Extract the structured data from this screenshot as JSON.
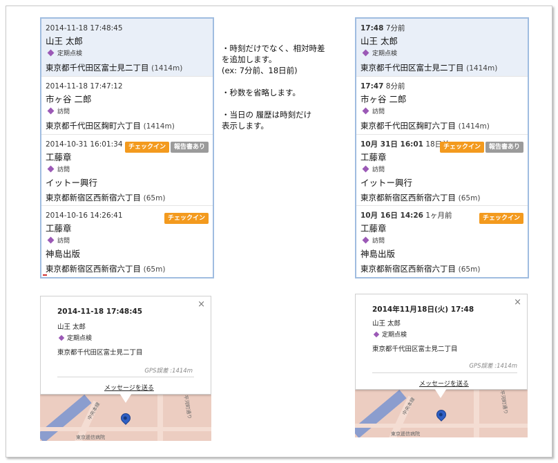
{
  "left_list": {
    "items": [
      {
        "time": "2014-11-18 17:48:45",
        "name": "山王 太郎",
        "tag": "定期点検",
        "sub": "",
        "address": "東京都千代田区富士見二丁目",
        "distance": "(1414m)",
        "badges": []
      },
      {
        "time": "2014-11-18 17:47:12",
        "name": "市ヶ谷 二郎",
        "tag": "訪問",
        "sub": "",
        "address": "東京都千代田区麹町六丁目",
        "distance": "(1414m)",
        "badges": []
      },
      {
        "time": "2014-10-31 16:01:34",
        "name": "工藤章",
        "tag": "訪問",
        "sub": "イットー興行",
        "address": "東京都新宿区西新宿六丁目",
        "distance": "(65m)",
        "badges": [
          "チェックイン",
          "報告書あり"
        ]
      },
      {
        "time": "2014-10-16 14:26:41",
        "name": "工藤章",
        "tag": "訪問",
        "sub": "神島出版",
        "address": "東京都新宿区西新宿六丁目",
        "distance": "(65m)",
        "badges": [
          "チェックイン"
        ]
      }
    ]
  },
  "right_list": {
    "items": [
      {
        "time": "17:48",
        "rel": "7分前",
        "name": "山王 太郎",
        "tag": "定期点検",
        "sub": "",
        "address": "東京都千代田区富士見二丁目",
        "distance": "(1414m)",
        "badges": []
      },
      {
        "time": "17:47",
        "rel": "8分前",
        "name": "市ヶ谷 二郎",
        "tag": "訪問",
        "sub": "",
        "address": "東京都千代田区麹町六丁目",
        "distance": "(1414m)",
        "badges": []
      },
      {
        "time": "10月 31日 16:01",
        "rel": "18日前",
        "name": "工藤章",
        "tag": "訪問",
        "sub": "イットー興行",
        "address": "東京都新宿区西新宿六丁目",
        "distance": "(65m)",
        "badges": [
          "チェックイン",
          "報告書あり"
        ]
      },
      {
        "time": "10月 16日 14:26",
        "rel": "1ヶ月前",
        "name": "工藤章",
        "tag": "訪問",
        "sub": "神島出版",
        "address": "東京都新宿区西新宿六丁目",
        "distance": "(65m)",
        "badges": [
          "チェックイン"
        ]
      }
    ]
  },
  "notes": {
    "line1": "・時刻だけでなく、相対時差",
    "line2": "を追加します。",
    "line3": "(ex: 7分前、18日前)",
    "line4": "・秒数を省略します。",
    "line5": "・当日の 履歴は時刻だけ",
    "line6": "表示します。"
  },
  "left_popup": {
    "title": "2014-11-18 17:48:45",
    "name": "山王 太郎",
    "tag": "定期点検",
    "address": "東京都千代田区富士見二丁目",
    "gps": "GPS誤差 :1414m",
    "message": "メッセージを送る",
    "close": "×"
  },
  "right_popup": {
    "title": "2014年11月18日(火) 17:48",
    "name": "山王 太郎",
    "tag": "定期点検",
    "address": "東京都千代田区富士見二丁目",
    "gps": "GPS誤差 :1414m",
    "message": "メッセージを送る",
    "close": "×"
  },
  "map_labels": {
    "hospital": "東京逓信病院",
    "street": "中央本線",
    "block": "平河町通り"
  },
  "colors": {
    "badge_checkin": "#f39a1e",
    "badge_report": "#9b9b9b",
    "tag_diamond": "#9b59b6",
    "selected_row": "#e9eff8",
    "list_border": "#9fbce0"
  }
}
